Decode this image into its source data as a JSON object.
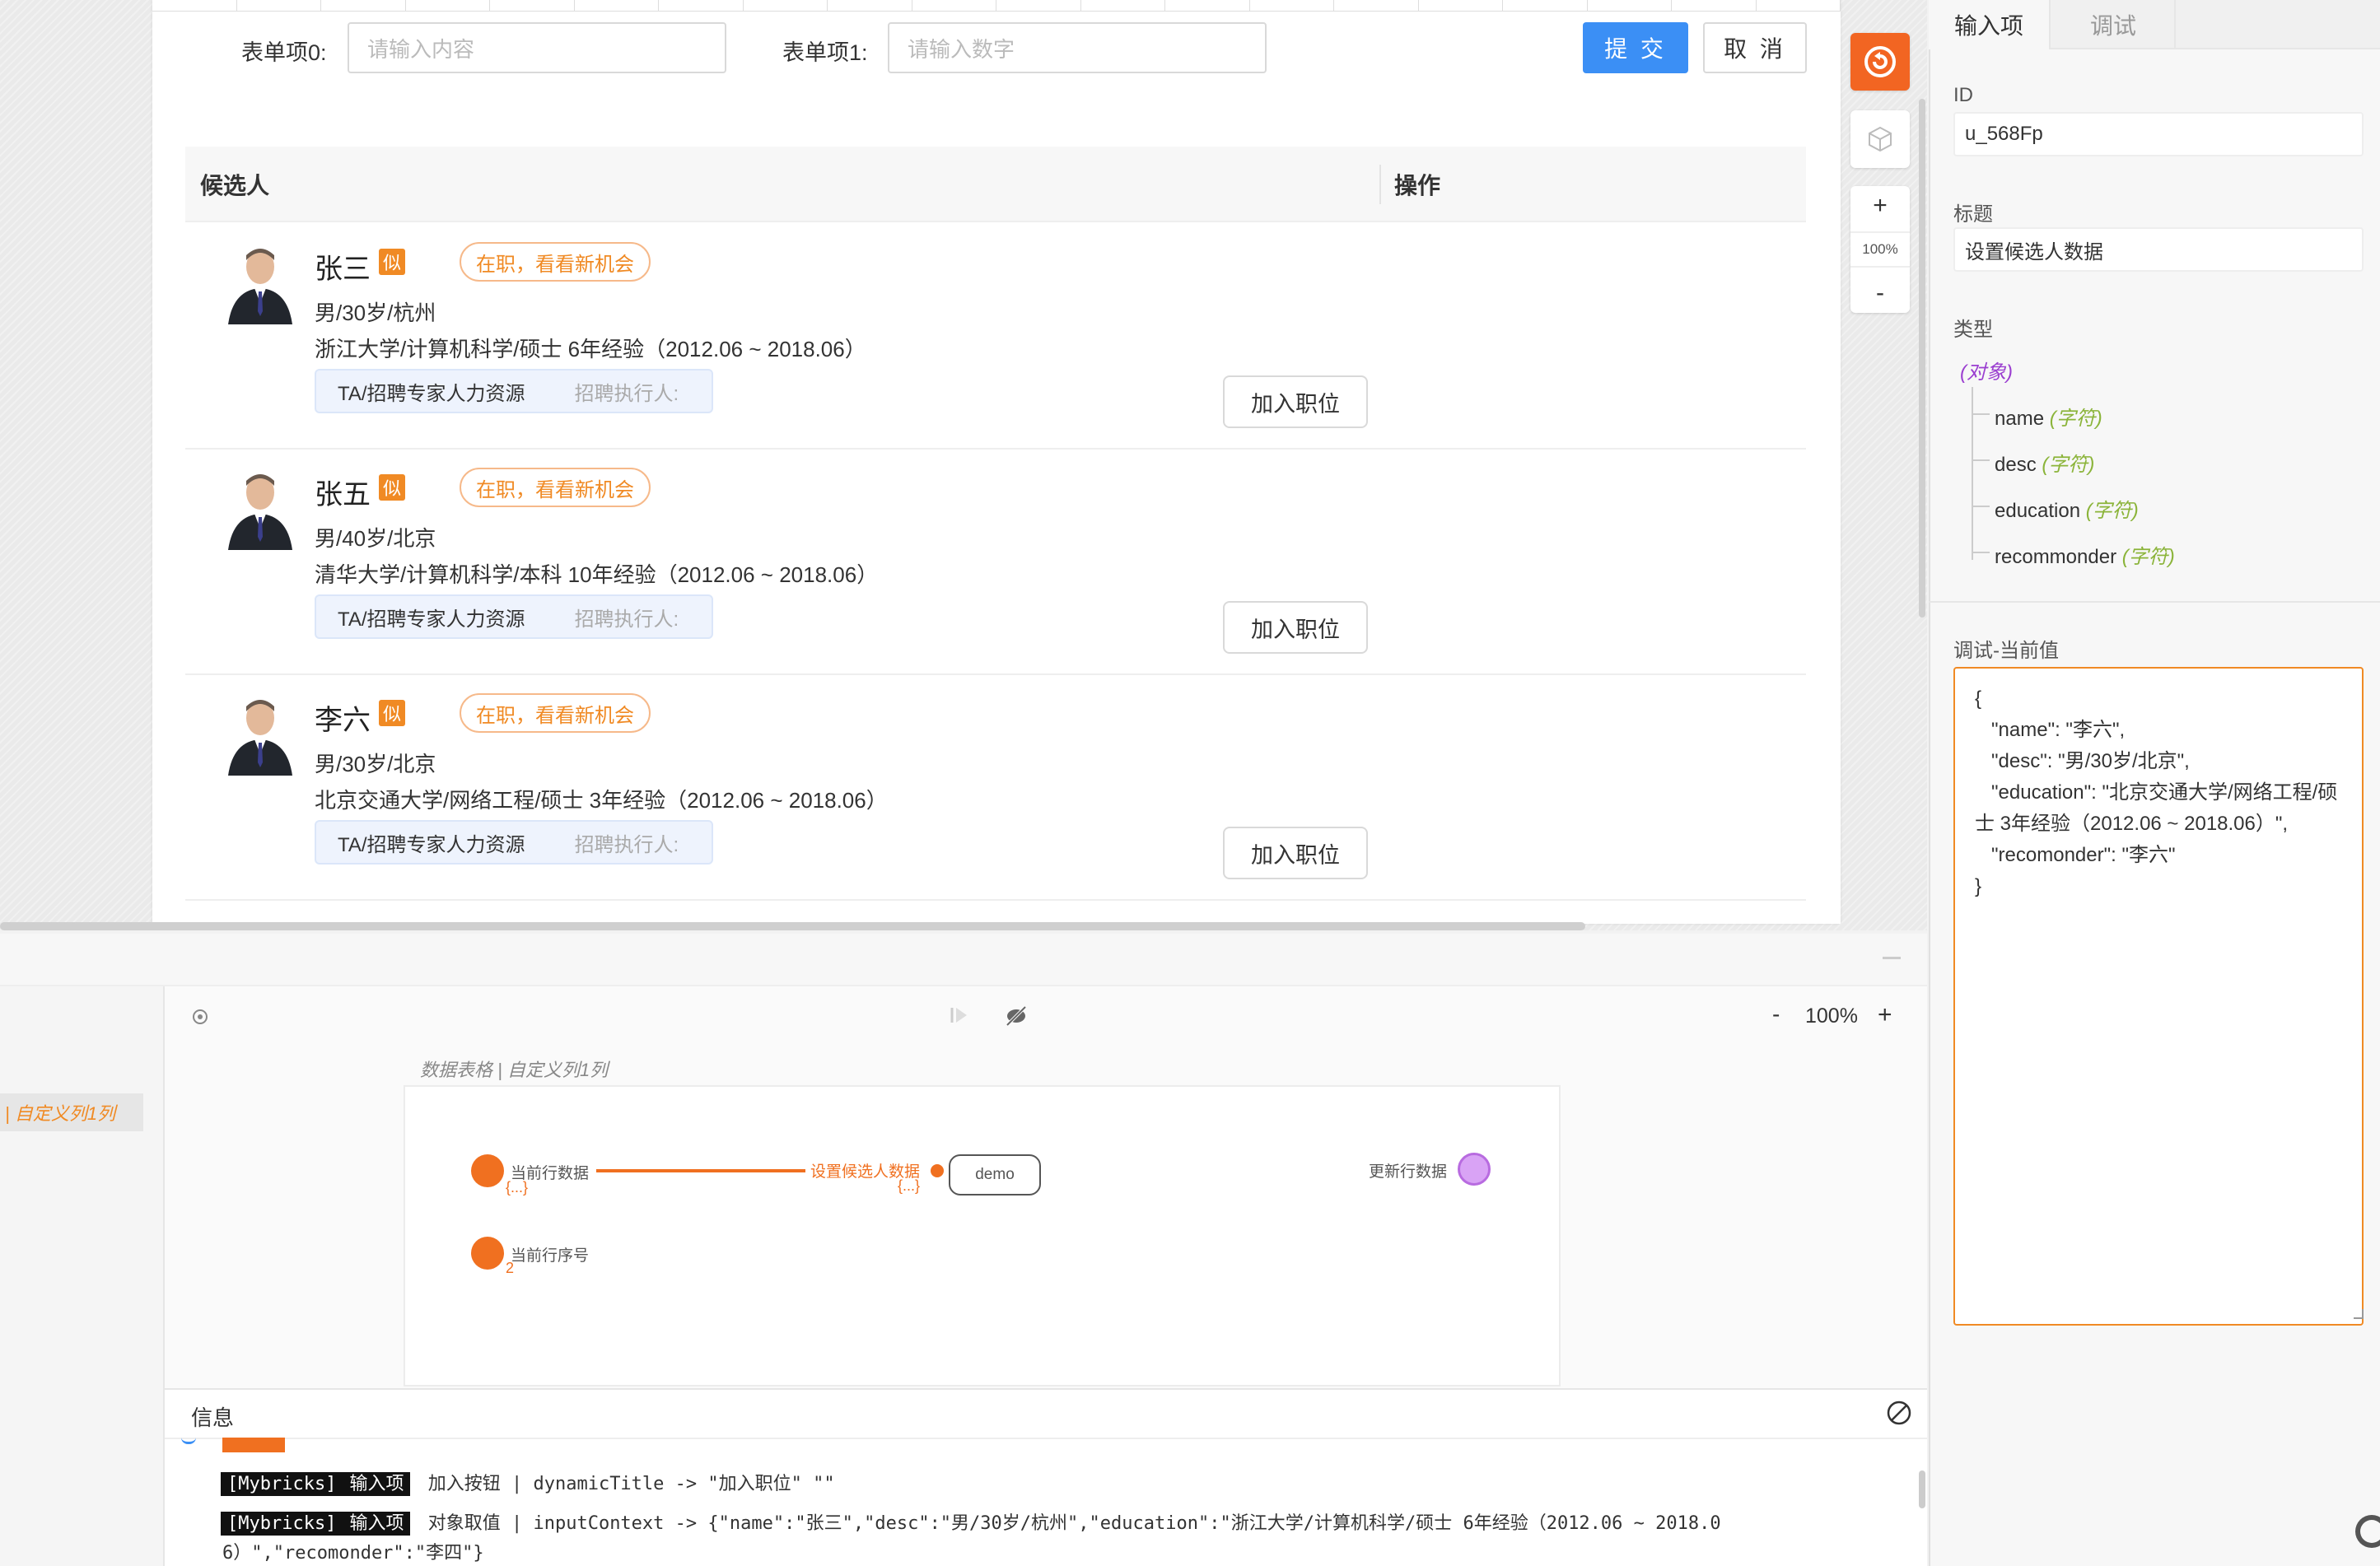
{
  "form": {
    "field0_label": "表单项0:",
    "field0_placeholder": "请输入内容",
    "field1_label": "表单项1:",
    "field1_placeholder": "请输入数字",
    "submit_label": "提 交",
    "cancel_label": "取 消"
  },
  "table": {
    "col_candidate": "候选人",
    "col_action": "操作",
    "rows": [
      {
        "name": "张三",
        "sim": "似",
        "status": "在职，看看新机会",
        "desc": "男/30岁/杭州",
        "education": "浙江大学/计算机科学/硕士 6年经验（2012.06 ~ 2018.06）",
        "tag": "TA/招聘专家人力资源",
        "executor": "招聘执行人:",
        "action": "加入职位"
      },
      {
        "name": "张五",
        "sim": "似",
        "status": "在职，看看新机会",
        "desc": "男/40岁/北京",
        "education": "清华大学/计算机科学/本科 10年经验（2012.06 ~ 2018.06）",
        "tag": "TA/招聘专家人力资源",
        "executor": "招聘执行人:",
        "action": "加入职位"
      },
      {
        "name": "李六",
        "sim": "似",
        "status": "在职，看看新机会",
        "desc": "男/30岁/北京",
        "education": "北京交通大学/网络工程/硕士 3年经验（2012.06 ~ 2018.06）",
        "tag": "TA/招聘专家人力资源",
        "executor": "招聘执行人:",
        "action": "加入职位"
      }
    ]
  },
  "zoom_tools": {
    "plus": "+",
    "level": "100%",
    "minus": "-"
  },
  "logic": {
    "zoom_minus": "-",
    "zoom_level": "100%",
    "zoom_plus": "+",
    "left_chip": "| 自定义列1列",
    "diagram_title": "数据表格 | 自定义列1列",
    "node_current_row": "当前行数据",
    "node_current_row_sub": "{...}",
    "node_set_data": "设置候选人数据",
    "node_set_data_sub": "{...}",
    "node_demo": "demo",
    "node_update_row": "更新行数据",
    "node_row_index": "当前行序号",
    "node_row_index_sub": "2"
  },
  "info": {
    "title": "信息",
    "lines": [
      {
        "tag": "[Mybricks]",
        "kind": "输入项",
        "name": "加入按钮",
        "detail": "| dynamicTitle -> \"加入职位\" \"\""
      },
      {
        "tag": "[Mybricks]",
        "kind": "输入项",
        "name": "对象取值",
        "detail": "| inputContext -> {\"name\":\"张三\",\"desc\":\"男/30岁/杭州\",\"education\":\"浙江大学/计算机科学/硕士 6年经验（2012.06 ~ 2018.0",
        "detail2": "6）\",\"recomonder\":\"李四\"}"
      }
    ]
  },
  "panel": {
    "tab_input": "输入项",
    "tab_debug": "调试",
    "id_label": "ID",
    "id_value": "u_568Fp",
    "title_label": "标题",
    "title_value": "设置候选人数据",
    "type_label": "类型",
    "type_root": "(对象)",
    "fields": [
      {
        "name": "name",
        "type": "(字符)"
      },
      {
        "name": "desc",
        "type": "(字符)"
      },
      {
        "name": "education",
        "type": "(字符)"
      },
      {
        "name": "recommonder",
        "type": "(字符)"
      }
    ],
    "debug_label": "调试-当前值",
    "debug_value": "{\n   \"name\": \"李六\",\n   \"desc\": \"男/30岁/北京\",\n   \"education\": \"北京交通大学/网络工程/硕士 3年经验（2012.06 ~ 2018.06）\",\n   \"recomonder\": \"李六\"\n}"
  },
  "colors": {
    "accent": "#f08a24",
    "primary": "#3b8ff5",
    "node": "#f07020",
    "update_pin": "#d9a3f5"
  }
}
